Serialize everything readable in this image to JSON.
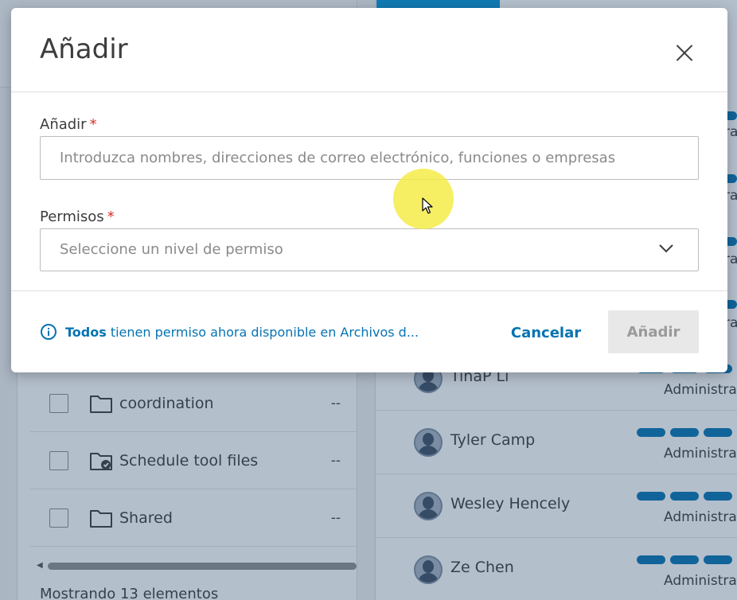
{
  "modal": {
    "title": "Añadir",
    "add_field": {
      "label": "Añadir",
      "required_mark": "*",
      "placeholder": "Introduzca nombres, direcciones de correo electrónico, funciones o empresas"
    },
    "permissions_field": {
      "label": "Permisos",
      "required_mark": "*",
      "placeholder": "Seleccione un nivel de permiso"
    },
    "info": {
      "strong": "Todos",
      "text": " tienen permiso ahora disponible en Archivos d..."
    },
    "cancel_label": "Cancelar",
    "add_label": "Añadir"
  },
  "background": {
    "files": [
      {
        "name": "coordination",
        "value": "--",
        "icon": "folder-icon"
      },
      {
        "name": "Schedule tool files",
        "value": "--",
        "icon": "folder-settings-icon"
      },
      {
        "name": "Shared",
        "value": "--",
        "icon": "folder-icon"
      }
    ],
    "footer_text": "Mostrando 13 elementos",
    "users": [
      {
        "name": "TinaP Li",
        "role": "Administra"
      },
      {
        "name": "Tyler Camp",
        "role": "Administra"
      },
      {
        "name": "Wesley Hencely",
        "role": "Administra"
      },
      {
        "name": "Ze Chen",
        "role": "Administra"
      }
    ],
    "edge_texts": [
      "ra",
      "ra",
      "ra",
      "ra"
    ]
  },
  "colors": {
    "accent": "#0673b3",
    "required": "#d93025",
    "overlay": "#28486e"
  }
}
